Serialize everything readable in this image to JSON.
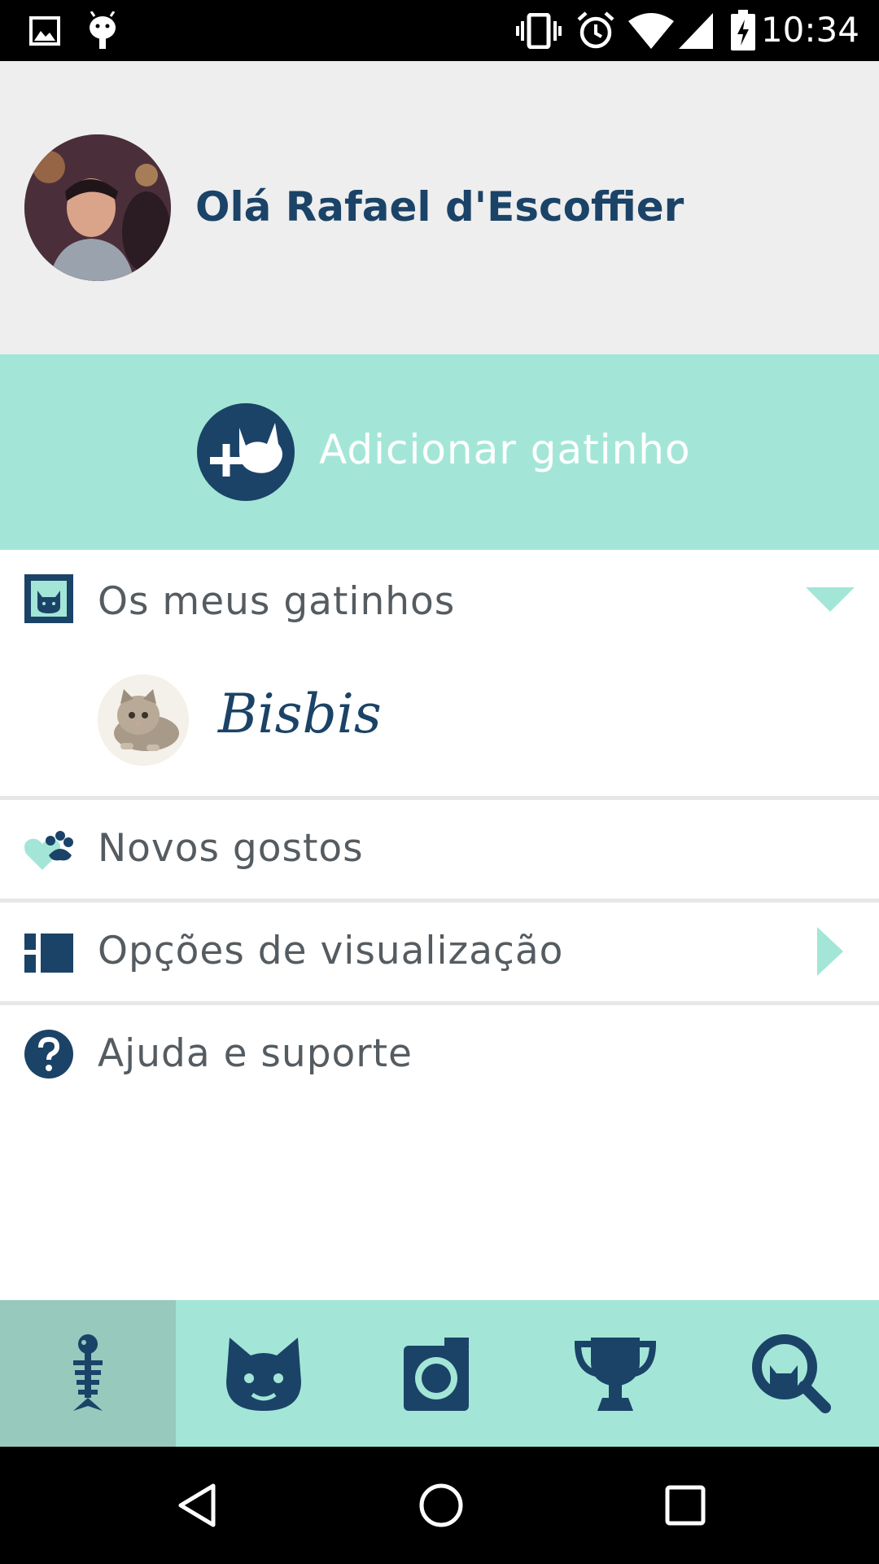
{
  "status_bar": {
    "time": "10:34",
    "icons": [
      "image-icon",
      "android-icon",
      "vibrate-icon",
      "alarm-icon",
      "wifi-icon",
      "signal-icon",
      "battery-charging-icon"
    ]
  },
  "header": {
    "greeting": "Olá Rafael d'Escoffier",
    "avatar_icon": "user-avatar"
  },
  "add_kitten": {
    "label": "Adicionar gatinho",
    "icon": "add-cat-icon"
  },
  "menu": {
    "my_kittens": {
      "label": "Os meus gatinhos",
      "icon": "cat-frame-icon",
      "expand_icon": "triangle-down-icon",
      "items": [
        {
          "name": "Bisbis",
          "icon": "kitten-photo"
        }
      ]
    },
    "new_likes": {
      "label": "Novos gostos",
      "icon": "heart-paw-icon"
    },
    "view_options": {
      "label": "Opções de visualização",
      "icon": "grid-icon",
      "chevron_icon": "triangle-right-icon"
    },
    "help": {
      "label": "Ajuda e suporte",
      "icon": "question-icon"
    }
  },
  "tab_bar": {
    "tabs": [
      {
        "icon": "fishbone-icon",
        "active": true
      },
      {
        "icon": "cat-face-icon",
        "active": false
      },
      {
        "icon": "camera-icon",
        "active": false
      },
      {
        "icon": "trophy-icon",
        "active": false
      },
      {
        "icon": "search-cat-icon",
        "active": false
      }
    ]
  },
  "nav_bar": {
    "buttons": [
      "back-icon",
      "home-icon",
      "recents-icon"
    ]
  },
  "colors": {
    "navy": "#1b4367",
    "mint": "#a3e6d7",
    "mint_active": "#97c9bd",
    "header_bg": "#eeeeee",
    "text_gray": "#555c61"
  }
}
